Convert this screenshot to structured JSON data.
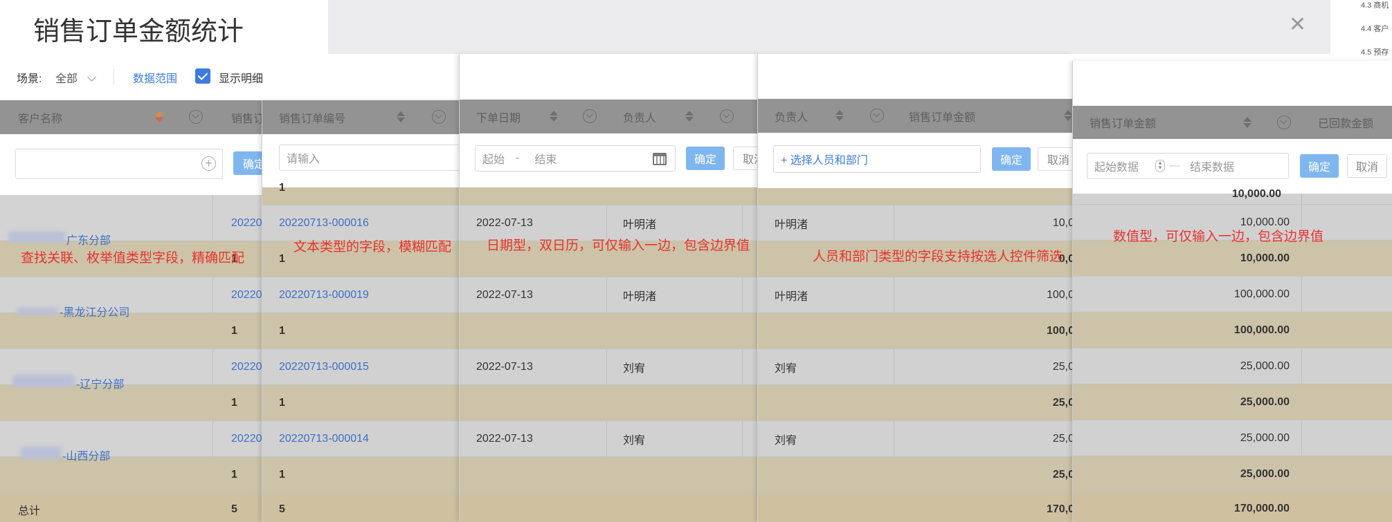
{
  "window": {
    "title": "销售订单金额统计"
  },
  "toc": {
    "items": [
      "4.3 商机",
      "4.4 客户",
      "4.5 预存"
    ]
  },
  "toolbar": {
    "scene_label": "场景:",
    "scene_value": "全部",
    "data_range_label": "数据范围",
    "show_detail_label": "显示明细"
  },
  "columns": {
    "customer": "客户名称",
    "order_no": "销售订单编号",
    "order_date": "下单日期",
    "owner": "负责人",
    "amount": "销售订单金额",
    "received": "已回款金额",
    "truncated_order": "销售订"
  },
  "filters": {
    "confirm": "确定",
    "confirm_trunc": "确定",
    "cancel": "取消",
    "cancel_trunc": "取消",
    "cancel_trunc2": "取消",
    "text_placeholder": "请输入",
    "date_start": "起始",
    "date_sep": "-",
    "date_end": "结束",
    "person_placeholder": "+ 选择人员和部门",
    "num_start": "起始数据",
    "num_sep": "—",
    "num_end": "结束数据"
  },
  "rows": [
    {
      "customer": "广东分部",
      "order_no": "20220713-000016",
      "order_prefix": "20220",
      "date": "2022-07-13",
      "owner": "叶明渚",
      "amount_trunc": "10,0",
      "amount": "10,000.00"
    },
    {
      "customer": "-黑龙江分公司",
      "order_no": "20220713-000019",
      "order_prefix": "20220",
      "date": "2022-07-13",
      "owner": "叶明渚",
      "amount_trunc": "100,0",
      "amount": "100,000.00"
    },
    {
      "customer": "-辽宁分部",
      "order_no": "20220713-000015",
      "order_prefix": "20220",
      "date": "2022-07-13",
      "owner": "刘宥",
      "amount_trunc": "25,0",
      "amount": "25,000.00"
    },
    {
      "customer": "-山西分部",
      "order_no": "20220713-000014",
      "order_prefix": "20220",
      "date": "2022-07-13",
      "owner": "刘宥",
      "amount_trunc": "25,0",
      "amount": "25,000.00"
    }
  ],
  "subtotals": [
    {
      "count": "1",
      "amount_trunc": "0,0",
      "amount": "10,000.00"
    },
    {
      "count": "1",
      "amount_trunc": "100,0",
      "amount": "100,000.00"
    },
    {
      "count": "1",
      "amount_trunc": "25,0",
      "amount": "25,000.00"
    },
    {
      "count": "1",
      "amount_trunc": "25,0",
      "amount": "25,000.00"
    }
  ],
  "partial_top": {
    "count": "1",
    "amount": "10,000.00"
  },
  "total": {
    "label": "总计",
    "count": "5",
    "amount_trunc": "170,0",
    "amount": "170,000.00"
  },
  "annotations": {
    "lookup": "查找关联、枚举值类型字段，精确匹配",
    "text": "文本类型的字段，模糊匹配",
    "date": "日期型，双日历，可仅输入一边，包含边界值",
    "person": "人员和部门类型的字段支持按选人控件筛选",
    "number": "数值型，可仅输入一边，包含边界值"
  }
}
